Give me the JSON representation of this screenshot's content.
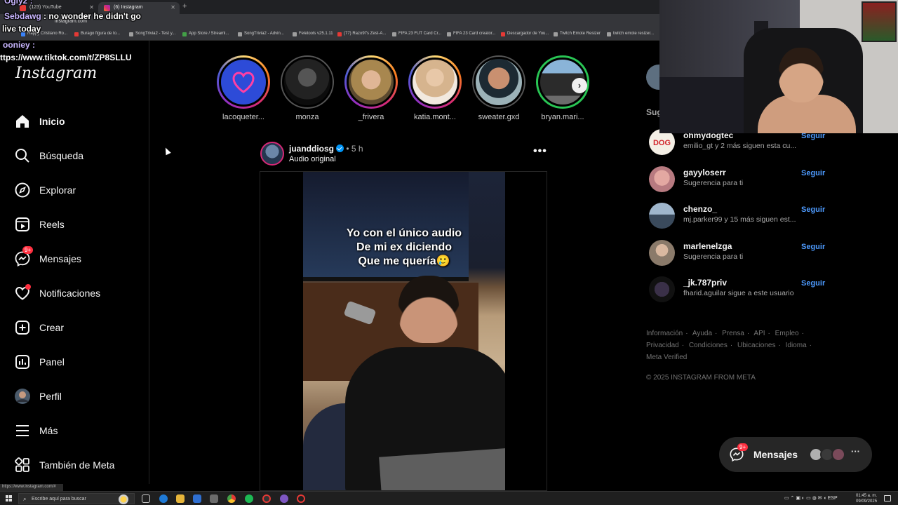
{
  "browser": {
    "tabs": [
      {
        "label": "(123) YouTube"
      },
      {
        "label": "(6) Instagram"
      }
    ],
    "new_tab": "+",
    "url": "instagram.com",
    "bookmarks": [
      {
        "label": "Happy Cristiano Ro...",
        "color": "#3b82f6"
      },
      {
        "label": "Burago figura de to...",
        "color": "#e53935"
      },
      {
        "label": "SongTrivia2 - Test y...",
        "color": "#9e9e9e"
      },
      {
        "label": "App Store / Streaml...",
        "color": "#43a047"
      },
      {
        "label": "SongTrivia2 - Advin...",
        "color": "#9e9e9e"
      },
      {
        "label": "Feletools v25.1.11",
        "color": "#9e9e9e"
      },
      {
        "label": "(77) Razo97s Zest-A...",
        "color": "#e53935"
      },
      {
        "label": "FIFA 23 FUT Card Cr...",
        "color": "#9e9e9e"
      },
      {
        "label": "FIFA 23 Card creator...",
        "color": "#9e9e9e"
      },
      {
        "label": "Descargador de You...",
        "color": "#e53935"
      },
      {
        "label": "Twitch Emote Resizer",
        "color": "#9e9e9e"
      },
      {
        "label": "twitch emote resizer...",
        "color": "#9e9e9e"
      }
    ],
    "status_url": "https://www.instagram.com/#"
  },
  "chat": {
    "lines": [
      {
        "user": "Ogiy2 :",
        "text": ""
      },
      {
        "user": "Sebdawg",
        "text": " : no wonder he didn't go"
      },
      {
        "user": "",
        "text": "live today"
      },
      {
        "user": "ooniey :",
        "text": ""
      },
      {
        "user": "",
        "text": "ttps://www.tiktok.com/t/ZP8SLLU"
      }
    ]
  },
  "instagram": {
    "logo": "Instagram",
    "nav": [
      {
        "label": "Inicio",
        "icon": "home-icon"
      },
      {
        "label": "Búsqueda",
        "icon": "search-icon"
      },
      {
        "label": "Explorar",
        "icon": "compass-icon"
      },
      {
        "label": "Reels",
        "icon": "reels-icon"
      },
      {
        "label": "Mensajes",
        "icon": "messenger-icon",
        "badge": "9+"
      },
      {
        "label": "Notificaciones",
        "icon": "heart-icon"
      },
      {
        "label": "Crear",
        "icon": "plus-square-icon"
      },
      {
        "label": "Panel",
        "icon": "dashboard-icon"
      },
      {
        "label": "Perfil",
        "icon": "avatar"
      },
      {
        "label": "Más",
        "icon": "menu-icon"
      },
      {
        "label": "También de Meta",
        "icon": "meta-apps-icon"
      }
    ],
    "stories": [
      {
        "name": "lacoqueter..."
      },
      {
        "name": "monza"
      },
      {
        "name": "_frivera"
      },
      {
        "name": "katia.mont..."
      },
      {
        "name": "sweater.gxd"
      },
      {
        "name": "bryan.mari..."
      }
    ],
    "post": {
      "username": "juanddiosg",
      "time": " • 5 h",
      "audio": "Audio original",
      "caption": "Yo con el único audio\nDe mi ex diciendo\nQue me quería🥲"
    },
    "suggestions_title": "Sug",
    "suggestions": [
      {
        "user": "ohmydogtec",
        "sub": "emilio_gt y 2 más siguen esta cu...",
        "follow": "Seguir"
      },
      {
        "user": "gayyloserr",
        "sub": "Sugerencia para ti",
        "follow": "Seguir"
      },
      {
        "user": "chenzo_",
        "sub": "mj.parker99 y 15 más siguen est...",
        "follow": "Seguir"
      },
      {
        "user": "marlenelzga",
        "sub": "Sugerencia para ti",
        "follow": "Seguir"
      },
      {
        "user": "_jk.787priv",
        "sub": "fharid.aguilar sigue a este usuario",
        "follow": "Seguir"
      }
    ],
    "footer_links": [
      "Información",
      "Ayuda",
      "Prensa",
      "API",
      "Empleo",
      "Privacidad",
      "Condiciones",
      "Ubicaciones",
      "Idioma",
      "Meta Verified"
    ],
    "copyright": "© 2025 INSTAGRAM FROM META",
    "messages_pill": {
      "label": "Mensajes",
      "badge": "9+"
    }
  },
  "taskbar": {
    "search_placeholder": "Escribe aquí para buscar",
    "tray": "ESP",
    "time": "01:45 a. m.",
    "date": "09/09/2025"
  },
  "colors": {
    "accent_link": "#4e9bff",
    "badge_red": "#ff3040",
    "verified_blue": "#0095f6"
  }
}
